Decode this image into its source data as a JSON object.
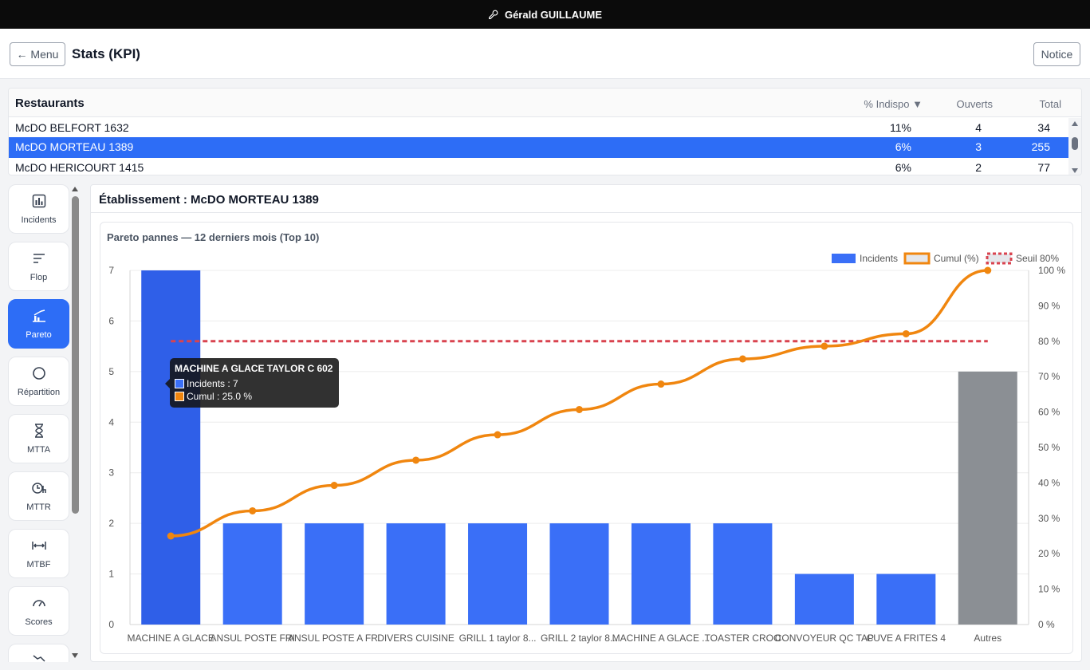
{
  "topbar": {
    "user": "Gérald GUILLAUME"
  },
  "header": {
    "menu_label": "← Menu",
    "title": "Stats (KPI)",
    "notice_label": "Notice"
  },
  "restaurants": {
    "title": "Restaurants",
    "columns": {
      "indispo": "% Indispo",
      "ouverts": "Ouverts",
      "total": "Total"
    },
    "rows": [
      {
        "name": "McDO BELFORT 1632",
        "indispo": "11%",
        "ouverts": "4",
        "total": "34"
      },
      {
        "name": "McDO MORTEAU 1389",
        "indispo": "6%",
        "ouverts": "3",
        "total": "255"
      },
      {
        "name": "McDO HERICOURT 1415",
        "indispo": "6%",
        "ouverts": "2",
        "total": "77"
      }
    ],
    "selected_index": 1
  },
  "sidebar": {
    "items": [
      {
        "label": "Incidents",
        "icon": "bar-chart-icon"
      },
      {
        "label": "Flop",
        "icon": "list-icon"
      },
      {
        "label": "Pareto",
        "icon": "pareto-icon",
        "active": true
      },
      {
        "label": "Répartition",
        "icon": "circle-icon"
      },
      {
        "label": "MTTA",
        "icon": "hourglass-icon"
      },
      {
        "label": "MTTR",
        "icon": "clock-h-icon"
      },
      {
        "label": "MTBF",
        "icon": "arrows-h-icon"
      },
      {
        "label": "Scores",
        "icon": "gauge-icon"
      }
    ]
  },
  "main": {
    "etablissement": "Établissement : McDO MORTEAU 1389"
  },
  "chart_data": {
    "type": "bar",
    "title": "Pareto pannes — 12 derniers mois (Top 10)",
    "categories": [
      "MACHINE A GLACE",
      "ANSUL POSTE FRI",
      "ANSUL POSTE A FR.",
      "DIVERS CUISINE",
      "GRILL 1 taylor 8...",
      "GRILL 2 taylor 8...",
      "MACHINE A GLACE ...",
      "TOASTER CROO",
      "CONVOYEUR QC TAP",
      "CUVE A FRITES 4",
      "Autres"
    ],
    "series": [
      {
        "name": "Incidents",
        "type": "bar",
        "values": [
          7,
          2,
          2,
          2,
          2,
          2,
          2,
          2,
          1,
          1,
          5
        ],
        "color": "#3a6ff7",
        "other_color": "#8b8f94"
      },
      {
        "name": "Cumul (%)",
        "type": "line",
        "axis": "right",
        "values": [
          25.0,
          32.1,
          39.3,
          46.4,
          53.6,
          60.7,
          67.9,
          75.0,
          78.6,
          82.1,
          100.0
        ],
        "color": "#f0860f"
      },
      {
        "name": "Seuil 80%",
        "type": "threshold",
        "axis": "right",
        "value": 80,
        "color": "#d9434f"
      }
    ],
    "y_left": {
      "min": 0,
      "max": 7,
      "ticks": [
        0,
        1,
        2,
        3,
        4,
        5,
        6,
        7
      ]
    },
    "y_right": {
      "min": 0,
      "max": 100,
      "ticks": [
        "0 %",
        "10 %",
        "20 %",
        "30 %",
        "40 %",
        "50 %",
        "60 %",
        "70 %",
        "80 %",
        "90 %",
        "100 %"
      ]
    },
    "legend_position": "top-right",
    "grid": true,
    "tooltip": {
      "title": "MACHINE A GLACE TAYLOR C 602",
      "incidents": "Incidents : 7",
      "cumul": "Cumul : 25.0 %"
    }
  }
}
